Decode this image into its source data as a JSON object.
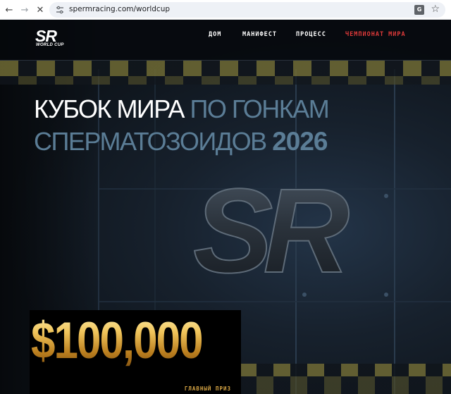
{
  "browser": {
    "url": "spermracing.com/worldcup",
    "icons": [
      "back-arrow-icon",
      "forward-arrow-icon",
      "close-icon",
      "site-info-icon",
      "translate-icon",
      "star-icon"
    ]
  },
  "nav": {
    "logo_main": "SR",
    "logo_sub": "WORLD CUP",
    "links": [
      {
        "label": "ДОМ"
      },
      {
        "label": "МАНИФЕСТ"
      },
      {
        "label": "ПРОЦЕСС"
      },
      {
        "label": "ЧЕМПИОНАТ МИРА"
      }
    ],
    "active_index": 3
  },
  "hero": {
    "line1_white": "КУБОК МИРА",
    "line1_blue": "ПО ГОНКАМ",
    "line2_blue": "СПЕРМАТОЗОИДОВ",
    "line2_year": "2026",
    "emblem_text": "SR"
  },
  "prize": {
    "amount": "$100,000",
    "label": "ГЛАВНЫЙ ПРИЗ"
  },
  "colors": {
    "accent_red": "#e03a3a",
    "headline_blue": "#5b7d96",
    "gold": "#e2b24a",
    "checker_yellow": "#6f6a34"
  }
}
